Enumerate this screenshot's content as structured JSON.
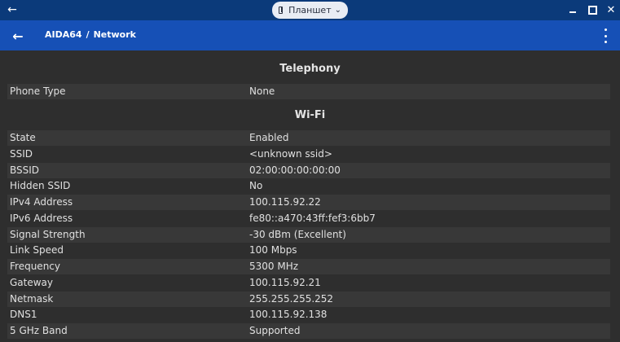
{
  "window": {
    "mode_label": "Планшет"
  },
  "appbar": {
    "app_name": "AIDA64",
    "separator": "/",
    "page_name": "Network"
  },
  "sections": {
    "telephony": {
      "title": "Telephony",
      "rows": [
        {
          "label": "Phone Type",
          "value": "None"
        }
      ]
    },
    "wifi": {
      "title": "Wi-Fi",
      "rows": [
        {
          "label": "State",
          "value": "Enabled"
        },
        {
          "label": "SSID",
          "value": "<unknown ssid>"
        },
        {
          "label": "BSSID",
          "value": "02:00:00:00:00:00"
        },
        {
          "label": "Hidden SSID",
          "value": "No"
        },
        {
          "label": "IPv4 Address",
          "value": "100.115.92.22"
        },
        {
          "label": "IPv6 Address",
          "value": "fe80::a470:43ff:fef3:6bb7"
        },
        {
          "label": "Signal Strength",
          "value": "-30 dBm (Excellent)"
        },
        {
          "label": "Link Speed",
          "value": "100 Mbps"
        },
        {
          "label": "Frequency",
          "value": "5300 MHz"
        },
        {
          "label": "Gateway",
          "value": "100.115.92.21"
        },
        {
          "label": "Netmask",
          "value": "255.255.255.252"
        },
        {
          "label": "DNS1",
          "value": "100.115.92.138"
        },
        {
          "label": "5 GHz Band",
          "value": "Supported"
        }
      ]
    }
  },
  "colors": {
    "titlebar": "#0b3a7a",
    "appbar": "#1650b6",
    "background": "#2e2e2e",
    "row_shade": "#383838"
  }
}
